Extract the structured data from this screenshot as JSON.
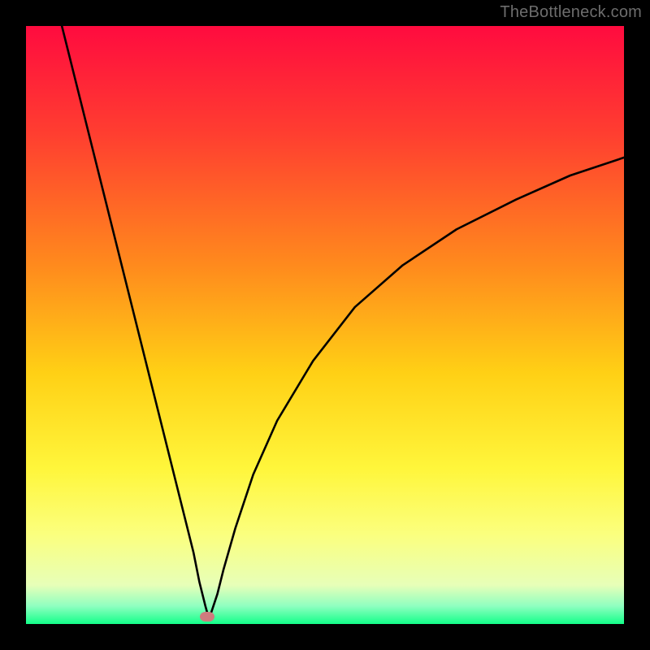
{
  "watermark": {
    "text": "TheBottleneck.com"
  },
  "chart_data": {
    "type": "line",
    "title": "",
    "xlabel": "",
    "ylabel": "",
    "xlim": [
      0,
      100
    ],
    "ylim": [
      0,
      100
    ],
    "gradient_stops": [
      {
        "offset": 0,
        "color": "#ff0b3f"
      },
      {
        "offset": 0.18,
        "color": "#ff3e30"
      },
      {
        "offset": 0.4,
        "color": "#ff8a1d"
      },
      {
        "offset": 0.58,
        "color": "#ffd015"
      },
      {
        "offset": 0.74,
        "color": "#fff63b"
      },
      {
        "offset": 0.85,
        "color": "#fbff7e"
      },
      {
        "offset": 0.935,
        "color": "#e7ffb8"
      },
      {
        "offset": 0.97,
        "color": "#8fffc0"
      },
      {
        "offset": 1.0,
        "color": "#13ff89"
      }
    ],
    "series": [
      {
        "name": "bottleneck-curve",
        "x": [
          6,
          8,
          10,
          12,
          14,
          16,
          18,
          20,
          22,
          24,
          26,
          28,
          29,
          30,
          30.5,
          31,
          32,
          33,
          35,
          38,
          42,
          48,
          55,
          63,
          72,
          82,
          91,
          100
        ],
        "y": [
          100,
          92,
          84,
          76,
          68,
          60,
          52,
          44,
          36,
          28,
          20,
          12,
          7,
          3,
          1.2,
          2,
          5,
          9,
          16,
          25,
          34,
          44,
          53,
          60,
          66,
          71,
          75,
          78
        ]
      }
    ],
    "marker": {
      "x": 30.3,
      "y": 1.2,
      "color": "#cf7b7e",
      "name": "min-point"
    }
  }
}
